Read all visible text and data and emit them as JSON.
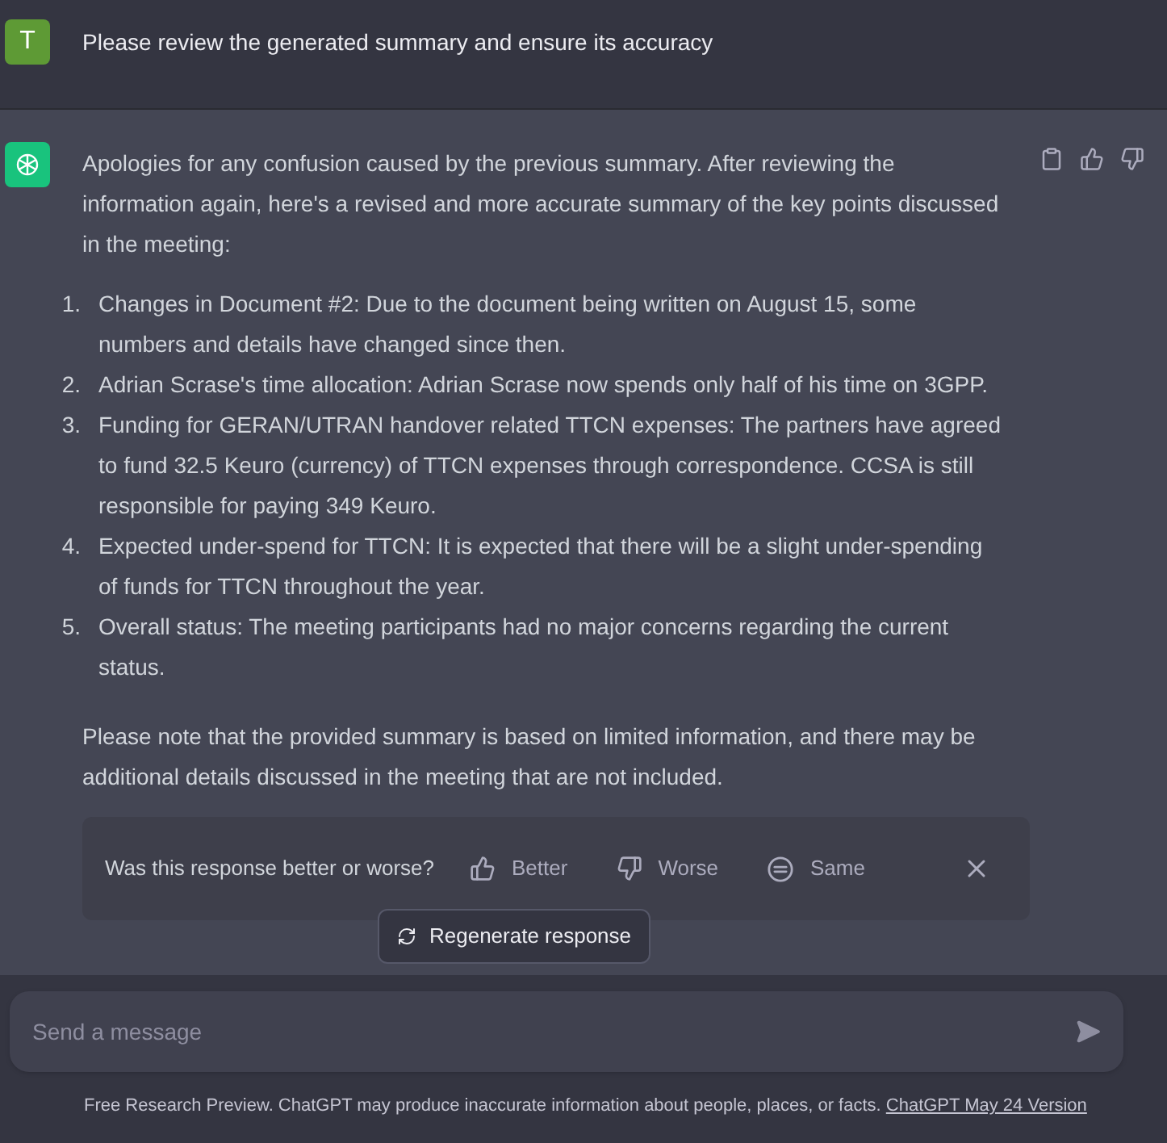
{
  "user_message": {
    "avatar": "T",
    "text": "Please review the generated summary and ensure its accuracy"
  },
  "assistant_message": {
    "intro": "Apologies for any confusion caused by the previous summary. After reviewing the information again, here's a revised and more accurate summary of the key points discussed in the meeting:",
    "points": [
      {
        "number": "1.",
        "text": "Changes in Document #2: Due to the document being written on August 15, some numbers and details have changed since then."
      },
      {
        "number": "2.",
        "text": "Adrian Scrase's time allocation: Adrian Scrase now spends only half of his time on 3GPP."
      },
      {
        "number": "3.",
        "text": "Funding for GERAN/UTRAN handover related TTCN expenses: The partners have agreed to fund 32.5 Keuro (currency) of TTCN expenses through correspondence. CCSA is still responsible for paying 349 Keuro."
      },
      {
        "number": "4.",
        "text": "Expected under-spend for TTCN: It is expected that there will be a slight under-spending of funds for TTCN throughout the year."
      },
      {
        "number": "5.",
        "text": "Overall status: The meeting participants had no major concerns regarding the current status."
      }
    ],
    "closing": "Please note that the provided summary is based on limited information, and there may be additional details discussed in the meeting that are not included."
  },
  "feedback": {
    "question": "Was this response better or worse?",
    "options": [
      {
        "kind": "better",
        "label": "Better"
      },
      {
        "kind": "worse",
        "label": "Worse"
      },
      {
        "kind": "same",
        "label": "Same"
      }
    ]
  },
  "regenerate_button": "Regenerate response",
  "composer": {
    "placeholder": "Send a message"
  },
  "footer": {
    "text": "Free Research Preview. ChatGPT may produce inaccurate information about people, places, or facts.",
    "link": "ChatGPT May 24 Version"
  }
}
